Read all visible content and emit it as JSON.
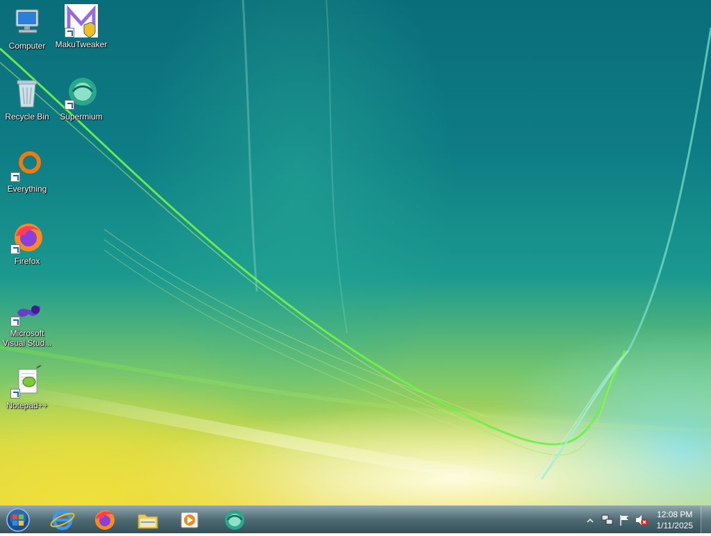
{
  "desktop": {
    "icons": [
      {
        "label": "Computer",
        "icon": "computer-icon"
      },
      {
        "label": "MakuTweaker",
        "icon": "makutweaker-icon"
      },
      {
        "label": "Recycle Bin",
        "icon": "recycle-bin-icon"
      },
      {
        "label": "Supermium",
        "icon": "supermium-icon"
      },
      {
        "label": "Everything",
        "icon": "everything-icon"
      },
      {
        "label": "Firefox",
        "icon": "firefox-icon"
      },
      {
        "label": "Microsoft Visual Stud...",
        "icon": "visual-studio-icon"
      },
      {
        "label": "Notepad++",
        "icon": "notepadpp-icon"
      }
    ]
  },
  "taskbar": {
    "pinned": [
      {
        "icon": "start-orb-icon"
      },
      {
        "icon": "internet-explorer-icon"
      },
      {
        "icon": "firefox-icon"
      },
      {
        "icon": "file-explorer-icon"
      },
      {
        "icon": "media-player-icon"
      },
      {
        "icon": "supermium-icon"
      }
    ],
    "tray": {
      "icons": [
        "show-hidden-icons-chevron",
        "network-icon",
        "action-center-flag-icon",
        "volume-muted-icon"
      ],
      "time": "12:08 PM",
      "date": "1/11/2025"
    }
  }
}
